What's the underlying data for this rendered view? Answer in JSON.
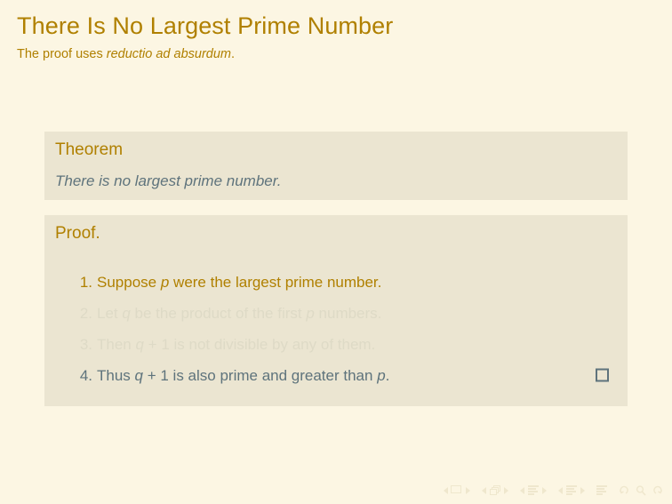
{
  "slide": {
    "title": "There Is No Largest Prime Number",
    "subtitle_lead": "The proof uses ",
    "subtitle_em": "reductio ad absurdum",
    "subtitle_tail": "."
  },
  "theorem_block": {
    "title": "Theorem",
    "body": "There is no largest prime number."
  },
  "proof_block": {
    "title": "Proof.",
    "items": [
      {
        "number": "1.",
        "parts": [
          {
            "text": "Suppose ",
            "style": "normal"
          },
          {
            "text": "p",
            "style": "italic"
          },
          {
            "text": " were the largest prime number.",
            "style": "normal"
          }
        ],
        "plain": "Suppose p were the largest prime number.",
        "state": "active"
      },
      {
        "number": "2.",
        "parts": [
          {
            "text": "Let ",
            "style": "normal"
          },
          {
            "text": "q",
            "style": "italic"
          },
          {
            "text": " be the product of the first ",
            "style": "normal"
          },
          {
            "text": "p",
            "style": "italic"
          },
          {
            "text": " numbers.",
            "style": "normal"
          }
        ],
        "plain": "Let q be the product of the first p numbers.",
        "state": "covered"
      },
      {
        "number": "3.",
        "parts": [
          {
            "text": "Then ",
            "style": "normal"
          },
          {
            "text": "q",
            "style": "italic"
          },
          {
            "text": " + 1 is not divisible by any of them.",
            "style": "normal"
          }
        ],
        "plain": "Then q + 1 is not divisible by any of them.",
        "state": "covered"
      },
      {
        "number": "4.",
        "parts": [
          {
            "text": "Thus ",
            "style": "normal"
          },
          {
            "text": "q",
            "style": "italic"
          },
          {
            "text": " + 1 is also prime and greater than ",
            "style": "normal"
          },
          {
            "text": "p",
            "style": "italic"
          },
          {
            "text": ".",
            "style": "normal"
          }
        ],
        "plain": "Thus q + 1 is also prime and greater than p.",
        "state": "current",
        "qed": true
      }
    ]
  },
  "navigation": {
    "items": [
      {
        "name": "prev-slide-button",
        "icon": "triangle-left-icon"
      },
      {
        "name": "slide-indicator",
        "icon": "slide-square-icon"
      },
      {
        "name": "next-slide-button",
        "icon": "triangle-right-icon"
      },
      {
        "name": "prev-frame-button",
        "icon": "triangle-left-icon"
      },
      {
        "name": "frame-indicator",
        "icon": "stacked-frames-icon"
      },
      {
        "name": "next-frame-button",
        "icon": "triangle-right-icon"
      },
      {
        "name": "prev-subsection-button",
        "icon": "triangle-left-icon"
      },
      {
        "name": "subsection-indicator",
        "icon": "text-lines-icon"
      },
      {
        "name": "next-subsection-button",
        "icon": "triangle-right-icon"
      },
      {
        "name": "prev-section-button",
        "icon": "triangle-left-icon"
      },
      {
        "name": "section-indicator",
        "icon": "text-lines-icon"
      },
      {
        "name": "next-section-button",
        "icon": "triangle-right-icon"
      },
      {
        "name": "presentation-indicator",
        "icon": "text-lines-icon"
      },
      {
        "name": "back-button",
        "icon": "undo-arrow-icon"
      },
      {
        "name": "search-button",
        "icon": "magnifier-icon"
      },
      {
        "name": "forward-button",
        "icon": "redo-arrow-icon"
      }
    ]
  },
  "colors": {
    "page_background": "#FCF6E3",
    "block_background": "#EBE5D1",
    "accent_gold": "#B08000",
    "body_slate": "#5E737C",
    "covered_text": "#DEDAC6",
    "nav_symbol": "#EFE7CD"
  }
}
